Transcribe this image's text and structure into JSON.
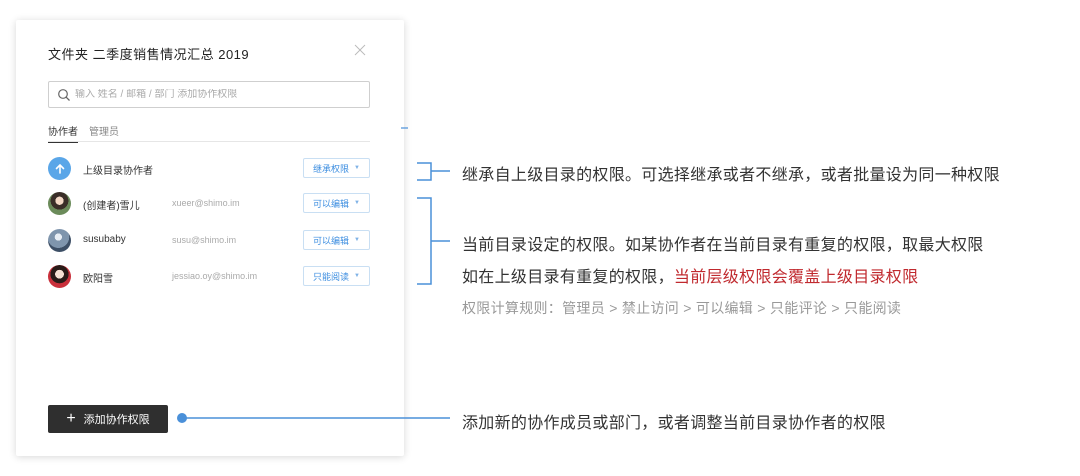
{
  "dialog": {
    "title": "文件夹  二季度销售情况汇总 2019",
    "close_icon": "close-icon",
    "search": {
      "placeholder": "输入 姓名 / 邮箱 / 部门 添加协作权限",
      "value": ""
    },
    "tabs": [
      {
        "label": "协作者",
        "active": true
      },
      {
        "label": "管理员",
        "active": false
      }
    ],
    "rows": [
      {
        "avatar": "arrow-up-icon",
        "name": "上级目录协作者",
        "email": "",
        "permission": "继承权限"
      },
      {
        "avatar": "user-avatar",
        "name": "(创建者)雪儿",
        "email": "xueer@shimo.im",
        "permission": "可以编辑"
      },
      {
        "avatar": "user-avatar",
        "name": "susubaby",
        "email": "susu@shimo.im",
        "permission": "可以编辑"
      },
      {
        "avatar": "user-avatar",
        "name": "欧阳雪",
        "email": "jessiao.oy@shimo.im",
        "permission": "只能阅读"
      }
    ],
    "add_button": "添加协作权限"
  },
  "annotations": {
    "inherit": "继承自上级目录的权限。可选择继承或者不继承，或者批量设为同一种权限",
    "current_line1": "当前目录设定的权限。如某协作者在当前目录有重复的权限，取最大权限",
    "current_line2_prefix": "如在上级目录有重复的权限，",
    "current_line2_highlight": "当前层级权限会覆盖上级目录权限",
    "rule": "权限计算规则：管理员 > 禁止访问 > 可以编辑 > 只能评论 > 只能阅读",
    "add": "添加新的协作成员或部门，或者调整当前目录协作者的权限"
  },
  "colors": {
    "accent": "#3d8ee0",
    "annotation_line": "#4a90d9",
    "highlight": "#c0292e",
    "button_bg": "#2f2f2f"
  }
}
